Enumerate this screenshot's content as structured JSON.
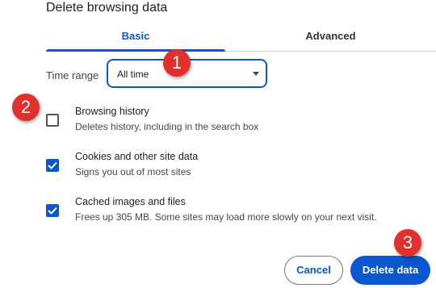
{
  "dialog": {
    "title": "Delete browsing data"
  },
  "tabs": [
    {
      "label": "Basic",
      "active": true
    },
    {
      "label": "Advanced",
      "active": false
    }
  ],
  "time_range": {
    "label": "Time range",
    "value": "All time"
  },
  "options": [
    {
      "title": "Browsing history",
      "description": "Deletes history, including in the search box",
      "checked": false
    },
    {
      "title": "Cookies and other site data",
      "description": "Signs you out of most sites",
      "checked": true
    },
    {
      "title": "Cached images and files",
      "description": "Frees up 305 MB. Some sites may load more slowly on your next visit.",
      "checked": true
    }
  ],
  "buttons": {
    "cancel": "Cancel",
    "delete": "Delete data"
  },
  "annotations": [
    "1",
    "2",
    "3"
  ],
  "colors": {
    "accent": "#0b57d0",
    "annotation": "#e0312e"
  }
}
